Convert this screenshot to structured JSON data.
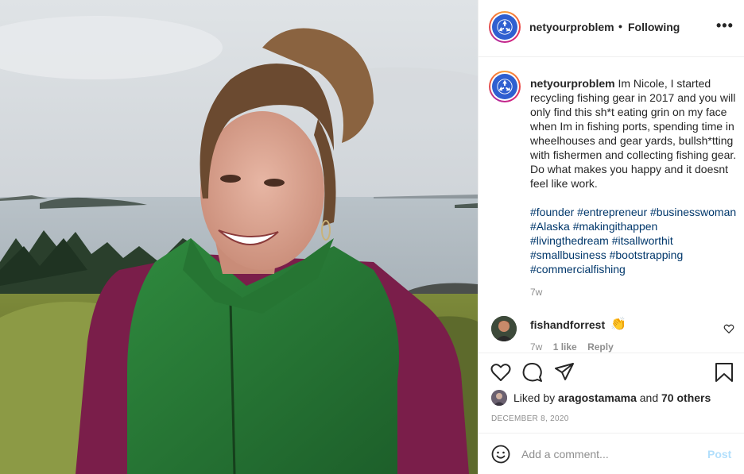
{
  "header": {
    "username": "netyourproblem",
    "separator": "•",
    "follow_status": "Following",
    "more_label": "•••"
  },
  "caption": {
    "username": "netyourproblem",
    "text": "Im Nicole, I started recycling fishing gear in 2017 and you will only find this sh*t eating grin on my face when Im in fishing ports, spending time in wheelhouses and gear yards, bullsh*tting with fishermen and collecting fishing gear. Do what makes you happy and it doesnt feel like work.",
    "hashtags": "#founder #entrepreneur #businesswoman #Alaska #makingithappen #livingthedream #itsallworthit #smallbusiness #bootstrapping #commercialfishing",
    "age": "7w"
  },
  "comment": {
    "username": "fishandforrest",
    "text": "👏",
    "age": "7w",
    "likes": "1 like",
    "reply": "Reply"
  },
  "likes": {
    "prefix": "Liked by ",
    "user": "aragostamama",
    "middle": " and ",
    "others": "70 others"
  },
  "date": "DECEMBER 8, 2020",
  "add_comment": {
    "placeholder": "Add a comment...",
    "post_label": "Post"
  },
  "icons": {
    "avatar": "recycle-logo-icon",
    "like": "heart-icon",
    "comment": "comment-icon",
    "share": "paper-plane-icon",
    "save": "bookmark-icon",
    "emoji": "smiley-icon"
  },
  "colors": {
    "link": "#00376b",
    "muted": "#8e8e8e",
    "post_disabled": "#b2dffc",
    "avatar_bg": "#2f5fd0"
  }
}
